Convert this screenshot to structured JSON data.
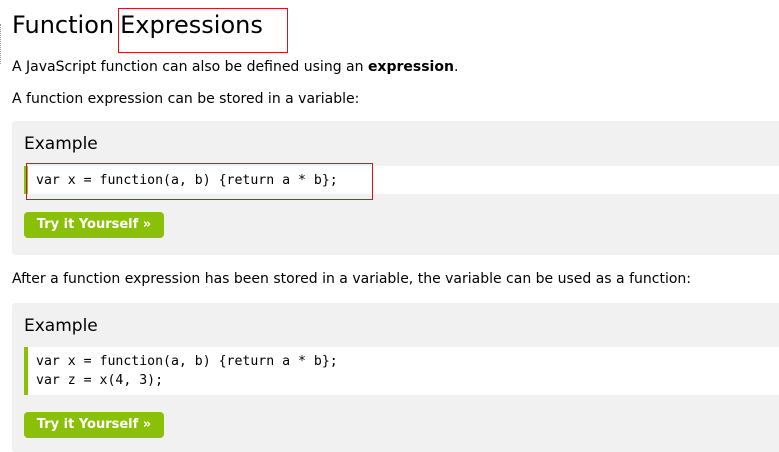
{
  "heading": {
    "word1": "Function",
    "word2": "Expressions"
  },
  "intro": {
    "text_before": "A JavaScript function can also be defined using an ",
    "bold": "expression",
    "text_after": "."
  },
  "para_stored": "A function expression can be stored in a variable:",
  "example1": {
    "title": "Example",
    "code_lines": [
      "var x = function(a, b) {return a * b};"
    ],
    "button_label": "Try it Yourself »"
  },
  "para_after": "After a function expression has been stored in a variable, the variable can be used as a function:",
  "example2": {
    "title": "Example",
    "code_lines": [
      "var x = function(a, b) {return a * b};",
      "var z = x(4, 3);"
    ],
    "button_label": "Try it Yourself »"
  },
  "colors": {
    "accent_green": "#8ac007",
    "example_background": "#f1f1f1",
    "highlight_red": "#e0111d"
  }
}
